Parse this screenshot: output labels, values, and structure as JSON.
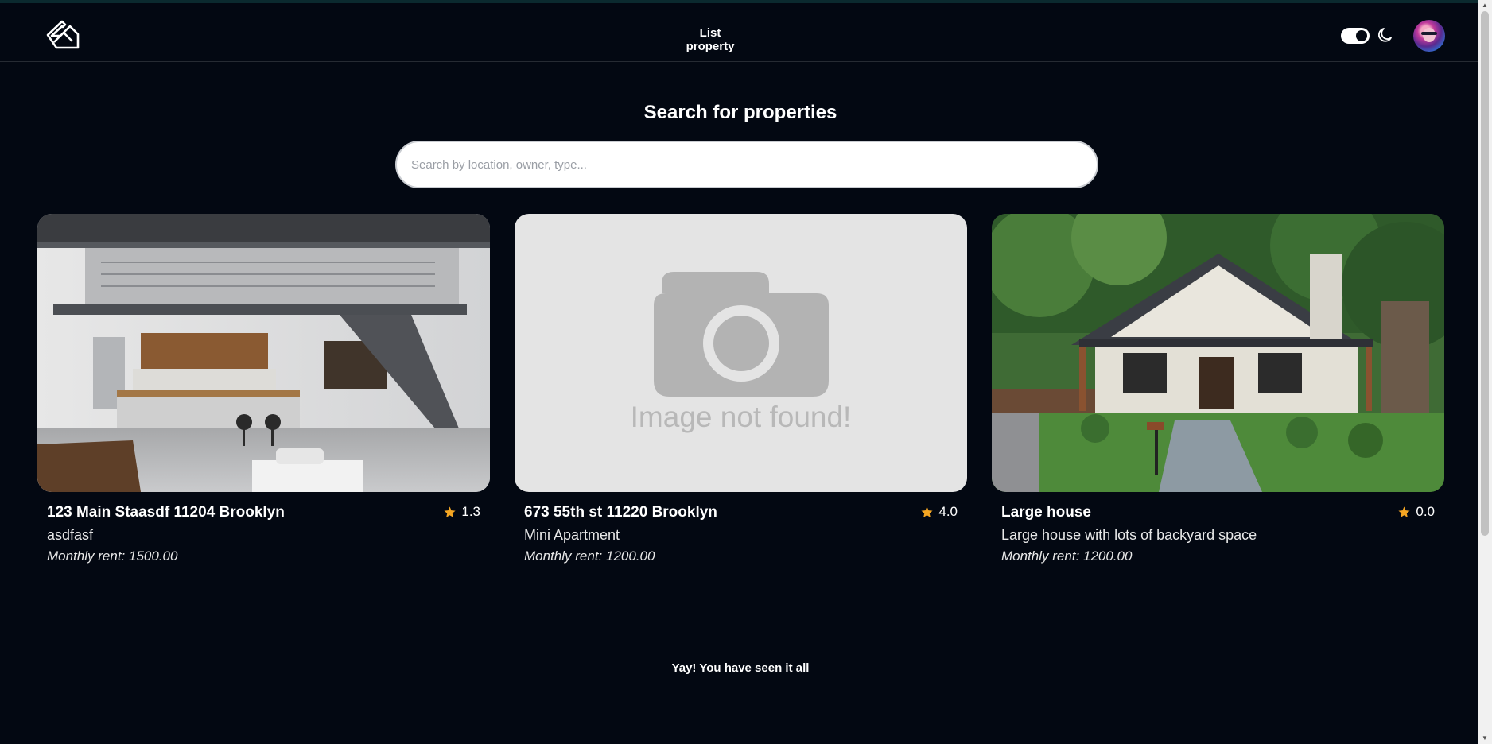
{
  "nav": {
    "logo_icon": "house-outline-logo-icon",
    "list_property_label": "List property",
    "theme_toggle_icon": "toggle-on-icon",
    "theme_icon": "moon-icon",
    "avatar_icon": "user-avatar"
  },
  "search": {
    "heading": "Search for properties",
    "placeholder": "Search by location, owner, type..."
  },
  "listings": [
    {
      "title": "123 Main Staasdf 11204 Brooklyn",
      "rating": "1.3",
      "description": "asdfasf",
      "rent": "Monthly rent: 1500.00",
      "image": "loft-interior-photo"
    },
    {
      "title": "673 55th st 11220 Brooklyn",
      "rating": "4.0",
      "description": "Mini Apartment",
      "rent": "Monthly rent: 1200.00",
      "image": "image-not-found-placeholder",
      "image_text": "Image not found!"
    },
    {
      "title": "Large house",
      "rating": "0.0",
      "description": "Large house with lots of backyard space",
      "rent": "Monthly rent: 1200.00",
      "image": "house-exterior-photo"
    }
  ],
  "footer": {
    "message": "Yay! You have seen it all"
  },
  "colors": {
    "background": "#030812",
    "star": "#f5a623",
    "search_bg": "#ffffff"
  }
}
